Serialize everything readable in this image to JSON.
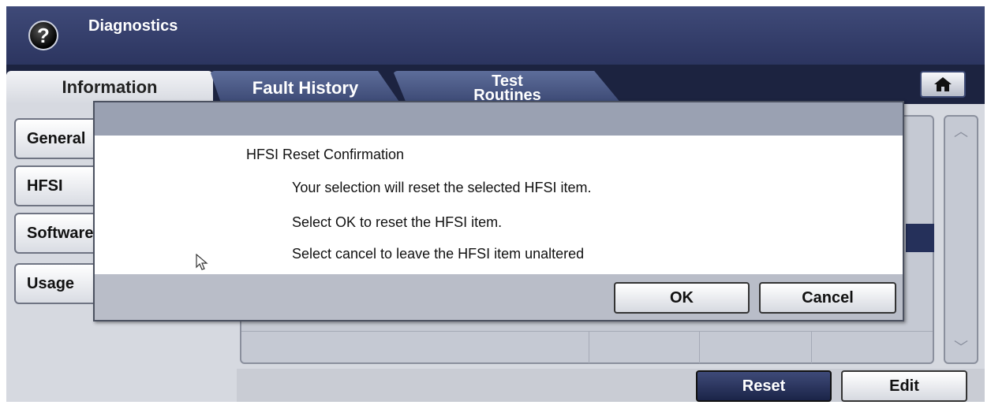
{
  "window": {
    "title": "Diagnostics",
    "help_icon": "help-icon",
    "help_glyph": "?"
  },
  "tabs": [
    {
      "label": "Information",
      "active": true
    },
    {
      "label": "Fault History",
      "active": false
    },
    {
      "label_line1": "Test",
      "label_line2": "Routines",
      "active": false
    }
  ],
  "home": {
    "icon": "home-icon"
  },
  "sidebar": {
    "items": [
      {
        "label": "General"
      },
      {
        "label": "HFSI"
      },
      {
        "label": "Software"
      },
      {
        "label": "Usage"
      }
    ]
  },
  "actions": {
    "reset_label": "Reset",
    "edit_label": "Edit"
  },
  "dialog": {
    "heading": "HFSI Reset Confirmation",
    "lines": [
      "Your selection will reset the selected HFSI item.",
      "Select OK to reset the HFSI item.",
      "Select cancel to leave the HFSI item unaltered"
    ],
    "ok_label": "OK",
    "cancel_label": "Cancel"
  },
  "colors": {
    "titlebar": "#3f4a78",
    "dialog_titlebar": "#9aa1b2",
    "reset_button": "#1b2448"
  }
}
